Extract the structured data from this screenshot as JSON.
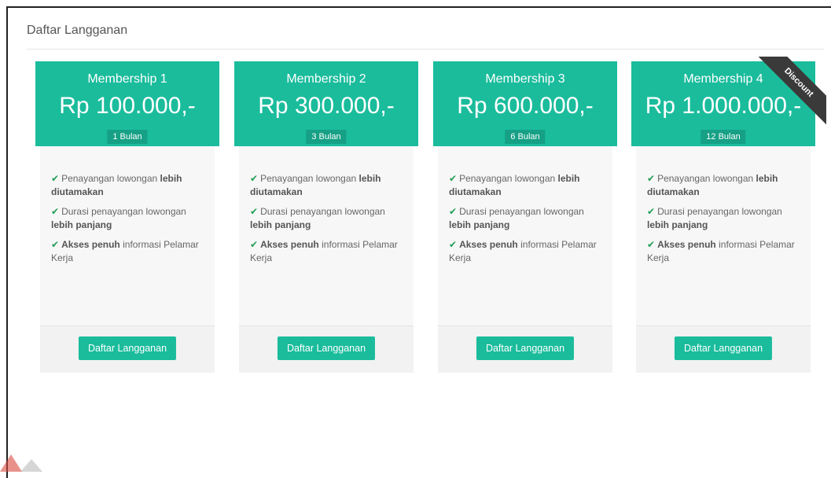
{
  "panel": {
    "title": "Daftar Langganan"
  },
  "plans": [
    {
      "name": "Membership 1",
      "price": "Rp 100.000,-",
      "duration": "1 Bulan",
      "ribbon": "",
      "features": [
        {
          "text1": "Penayangan lowongan ",
          "bold": "lebih diutamakan",
          "text2": ""
        },
        {
          "text1": "Durasi penayangan lowongan ",
          "bold": "lebih panjang",
          "text2": ""
        },
        {
          "text1": "",
          "bold": "Akses penuh",
          "text2": " informasi Pelamar Kerja"
        }
      ],
      "button": "Daftar Langganan"
    },
    {
      "name": "Membership 2",
      "price": "Rp 300.000,-",
      "duration": "3 Bulan",
      "ribbon": "",
      "features": [
        {
          "text1": "Penayangan lowongan ",
          "bold": "lebih diutamakan",
          "text2": ""
        },
        {
          "text1": "Durasi penayangan lowongan ",
          "bold": "lebih panjang",
          "text2": ""
        },
        {
          "text1": "",
          "bold": "Akses penuh",
          "text2": " informasi Pelamar Kerja"
        }
      ],
      "button": "Daftar Langganan"
    },
    {
      "name": "Membership 3",
      "price": "Rp 600.000,-",
      "duration": "6 Bulan",
      "ribbon": "",
      "features": [
        {
          "text1": "Penayangan lowongan ",
          "bold": "lebih diutamakan",
          "text2": ""
        },
        {
          "text1": "Durasi penayangan lowongan ",
          "bold": "lebih panjang",
          "text2": ""
        },
        {
          "text1": "",
          "bold": "Akses penuh",
          "text2": " informasi Pelamar Kerja"
        }
      ],
      "button": "Daftar Langganan"
    },
    {
      "name": "Membership 4",
      "price": "Rp 1.000.000,-",
      "duration": "12 Bulan",
      "ribbon": "Discount",
      "features": [
        {
          "text1": "Penayangan lowongan ",
          "bold": "lebih diutamakan",
          "text2": ""
        },
        {
          "text1": "Durasi penayangan lowongan ",
          "bold": "lebih panjang",
          "text2": ""
        },
        {
          "text1": "",
          "bold": "Akses penuh",
          "text2": " informasi Pelamar Kerja"
        }
      ],
      "button": "Daftar Langganan"
    }
  ],
  "colors": {
    "accent": "#1abc9c",
    "accent_dark": "#16a085",
    "check": "#1f9d55",
    "ribbon": "#3a3a3a"
  },
  "icons": {
    "feature_check": "check-icon"
  }
}
